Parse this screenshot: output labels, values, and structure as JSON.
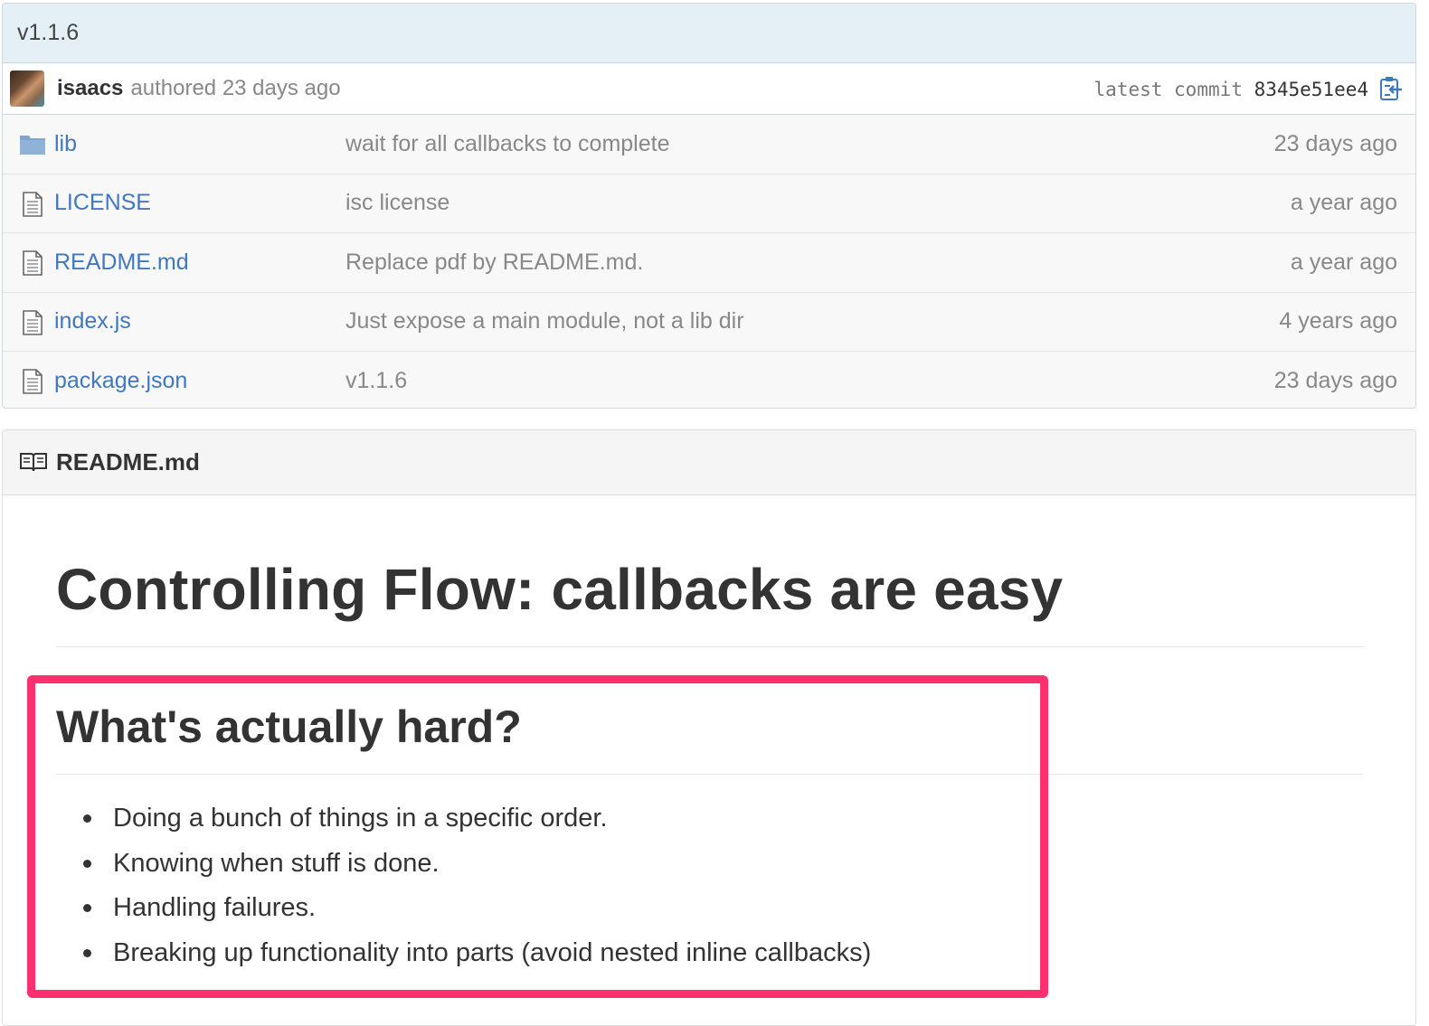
{
  "branch": {
    "version": "v1.1.6"
  },
  "commit": {
    "author": "isaacs",
    "authored_text": "authored 23 days ago",
    "latest_label": "latest commit",
    "sha": "8345e51ee4"
  },
  "files": [
    {
      "type": "folder",
      "name": "lib",
      "message": "wait for all callbacks to complete",
      "age": "23 days ago"
    },
    {
      "type": "file",
      "name": "LICENSE",
      "message": "isc license",
      "age": "a year ago"
    },
    {
      "type": "file",
      "name": "README.md",
      "message": "Replace pdf by README.md.",
      "age": "a year ago"
    },
    {
      "type": "file",
      "name": "index.js",
      "message": "Just expose a main module, not a lib dir",
      "age": "4 years ago"
    },
    {
      "type": "file",
      "name": "package.json",
      "message": "v1.1.6",
      "age": "23 days ago"
    }
  ],
  "readme": {
    "filename": "README.md",
    "h1": "Controlling Flow: callbacks are easy",
    "h2": "What's actually hard?",
    "bullets": [
      "Doing a bunch of things in a specific order.",
      "Knowing when stuff is done.",
      "Handling failures.",
      "Breaking up functionality into parts (avoid nested inline callbacks)"
    ]
  },
  "colors": {
    "link": "#4078c0",
    "highlight": "#fe2f6e",
    "folder": "#80a6cd"
  }
}
